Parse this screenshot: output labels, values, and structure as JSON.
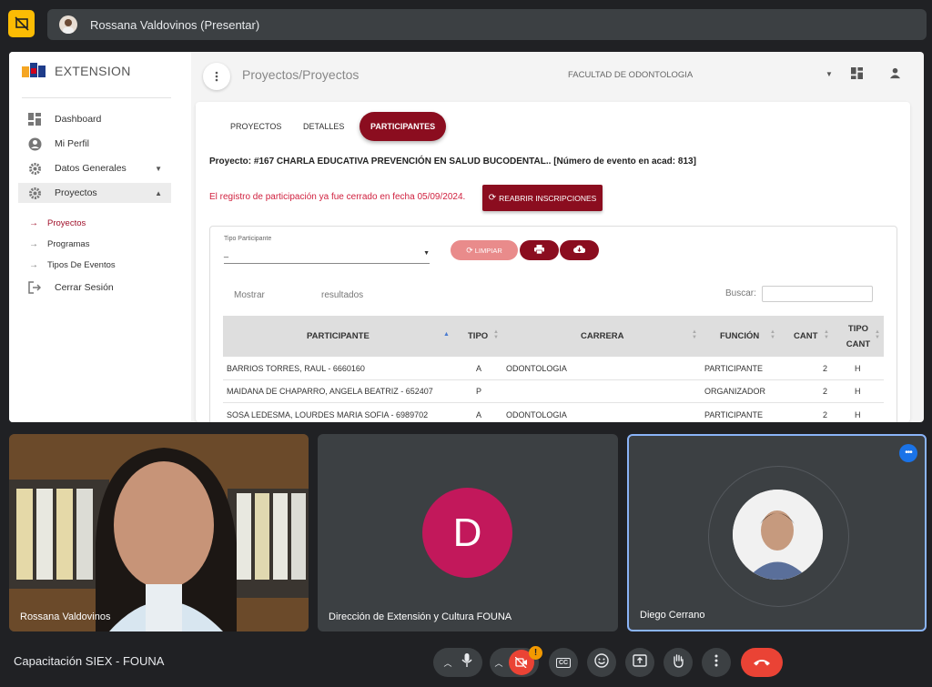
{
  "topbar": {
    "presenter": "Rossana Valdovinos (Presentar)"
  },
  "app": {
    "brand": "EXTENSION",
    "breadcrumb": "Proyectos/Proyectos",
    "faculty": "FACULTAD DE ODONTOLOGIA",
    "sidebar": {
      "items": [
        {
          "label": "Dashboard"
        },
        {
          "label": "Mi Perfil"
        },
        {
          "label": "Datos Generales"
        },
        {
          "label": "Proyectos"
        },
        {
          "label": "Cerrar Sesión"
        }
      ],
      "subitems": [
        {
          "label": "Proyectos"
        },
        {
          "label": "Programas"
        },
        {
          "label": "Tipos De Eventos"
        }
      ]
    },
    "tabs": [
      "PROYECTOS",
      "DETALLES",
      "PARTICIPANTES"
    ],
    "project_line": "Proyecto: #167 CHARLA EDUCATIVA PREVENCIÓN EN SALUD BUCODENTAL.. [Número de evento en acad: 813]",
    "closed_msg": "El registro de participación ya fue cerrado en fecha 05/09/2024.",
    "reopen_label": "REABRIR INSCRIPCIONES",
    "filter": {
      "label": "Tipo Participante",
      "value": "_"
    },
    "limpiar_label": "LIMPIAR",
    "mostrar": "Mostrar",
    "resultados": "resultados",
    "buscar": "Buscar:",
    "table": {
      "headers": [
        "PARTICIPANTE",
        "TIPO",
        "CARRERA",
        "FUNCIÓN",
        "CANT",
        "TIPO",
        "CANT"
      ],
      "rows": [
        [
          "BARRIOS TORRES, RAUL - 6660160",
          "A",
          "ODONTOLOGIA",
          "PARTICIPANTE",
          "2",
          "H"
        ],
        [
          "MAIDANA DE CHAPARRO, ANGELA BEATRIZ - 652407",
          "P",
          "",
          "ORGANIZADOR",
          "2",
          "H"
        ],
        [
          "SOSA LEDESMA, LOURDES MARIA SOFIA - 6989702",
          "A",
          "ODONTOLOGIA",
          "PARTICIPANTE",
          "2",
          "H"
        ]
      ]
    }
  },
  "tiles": {
    "t1": {
      "name": "Rossana Valdovinos"
    },
    "t2": {
      "name": "Dirección de Extensión y Cultura FOUNA",
      "initial": "D"
    },
    "t3": {
      "name": "Diego Cerrano"
    }
  },
  "bottom": {
    "meeting_title": "Capacitación SIEX - FOUNA",
    "alert_badge": "!",
    "captions_label": "CC"
  },
  "colors": {
    "brand": "#8b0d1f",
    "end_call": "#ea4335",
    "tile_avatar_d": "#c2185b",
    "active_speaker": "#8ab4f8"
  }
}
